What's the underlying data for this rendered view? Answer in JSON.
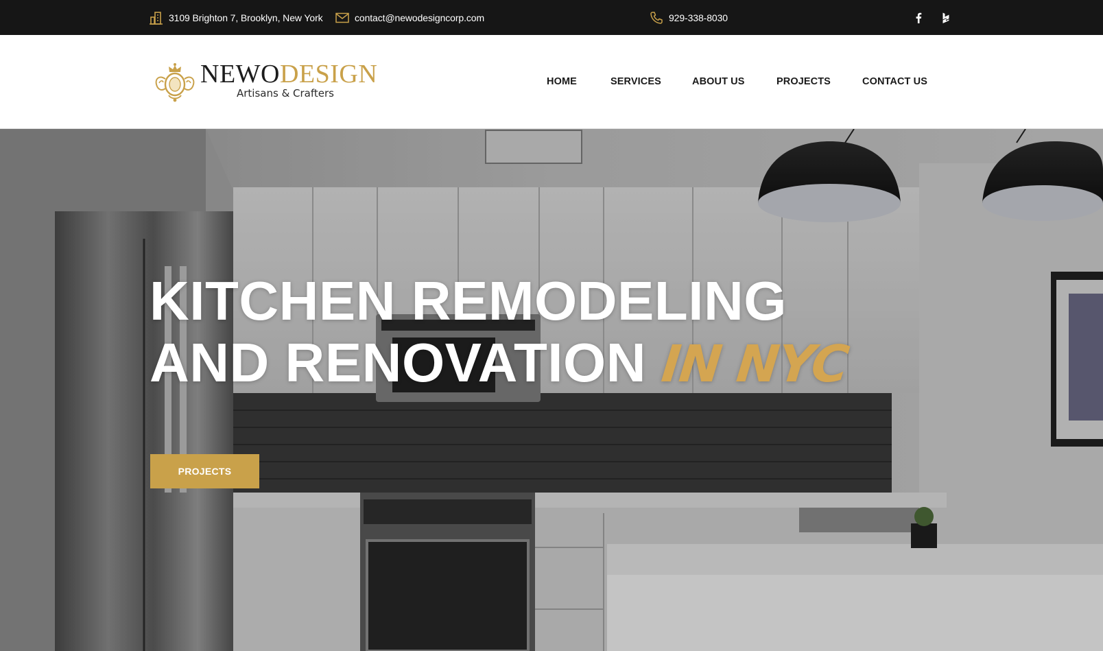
{
  "topbar": {
    "address": "3109 Brighton 7, Brooklyn, New York",
    "email": "contact@newodesigncorp.com",
    "phone": "929-338-8030",
    "social": [
      "facebook-icon",
      "houzz-icon"
    ]
  },
  "logo": {
    "name_dark": "NEWO",
    "name_gold": "DESIGN",
    "tagline": "Artisans & Crafters"
  },
  "nav": {
    "items": [
      "HOME",
      "SERVICES",
      "ABOUT US",
      "PROJECTS",
      "CONTACT US"
    ]
  },
  "hero": {
    "line1": "KITCHEN REMODELING",
    "line2": "AND RENOVATION",
    "accent": "IN NYC",
    "button_label": "PROJECTS"
  },
  "colors": {
    "topbar_bg": "#161616",
    "gold_accent": "#c9a14a",
    "nav_text": "#1a1a1a"
  }
}
